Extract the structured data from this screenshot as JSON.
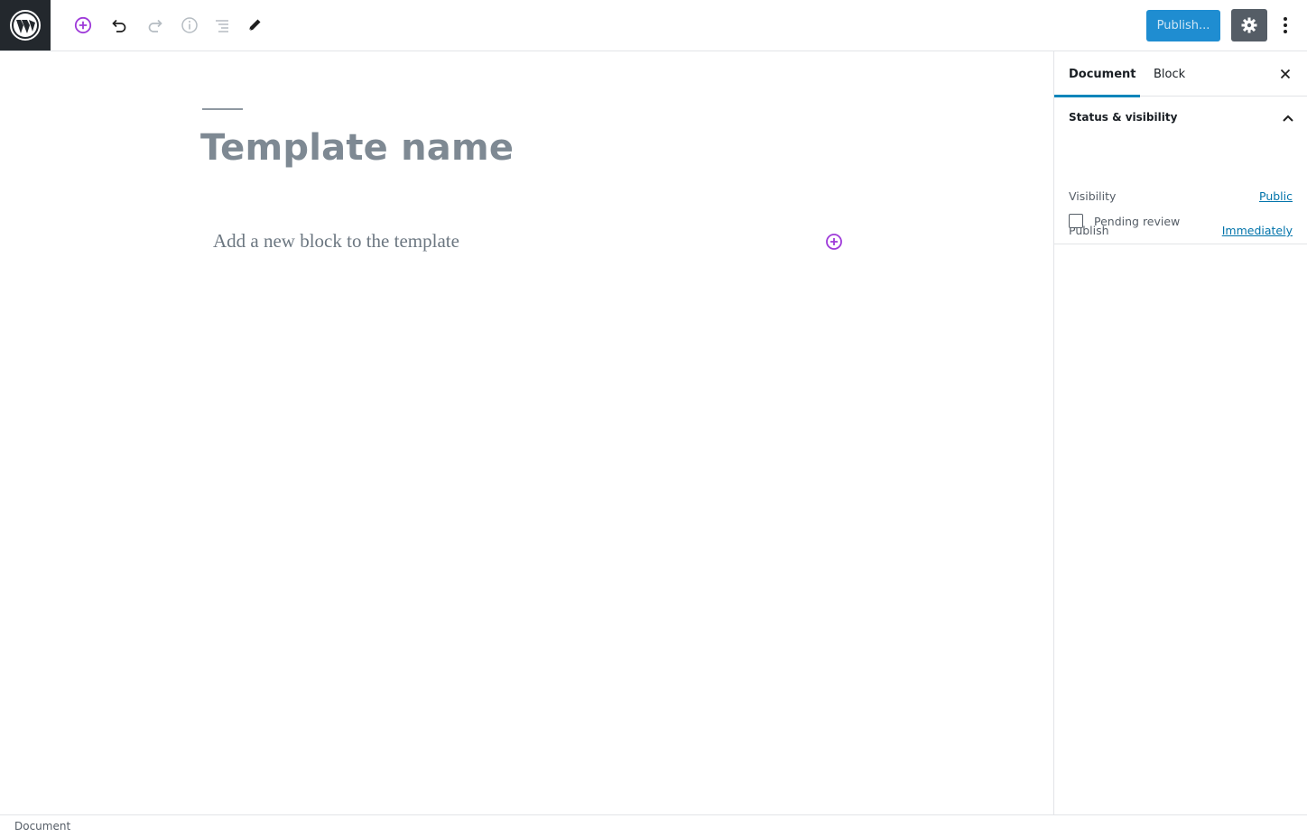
{
  "toolbar": {
    "logo_icon": "wordpress-logo-icon",
    "add_block_icon": "plus-circle-icon",
    "undo_icon": "undo-icon",
    "redo_icon": "redo-icon",
    "info_icon": "info-icon",
    "outline_icon": "list-view-icon",
    "tools_icon": "pencil-icon",
    "publish_label": "Publish...",
    "settings_icon": "gear-icon",
    "more_icon": "more-vertical-icon",
    "accent_color": "#9e3ad9",
    "publish_color": "#1f8dd1"
  },
  "editor": {
    "title": "Template name",
    "block_placeholder": "Add a new block to the template",
    "inserter_icon": "plus-circle-icon"
  },
  "sidebar": {
    "tabs": [
      {
        "label": "Document",
        "active": true
      },
      {
        "label": "Block",
        "active": false
      }
    ],
    "close_icon": "close-icon",
    "panel": {
      "title": "Status & visibility",
      "toggle_icon": "chevron-up-icon",
      "rows": [
        {
          "label": "Visibility",
          "value": "Public"
        },
        {
          "label": "Publish",
          "value": "Immediately"
        }
      ],
      "pending_review": {
        "label": "Pending review",
        "checked": false
      }
    }
  },
  "footer": {
    "breadcrumb": "Document"
  }
}
